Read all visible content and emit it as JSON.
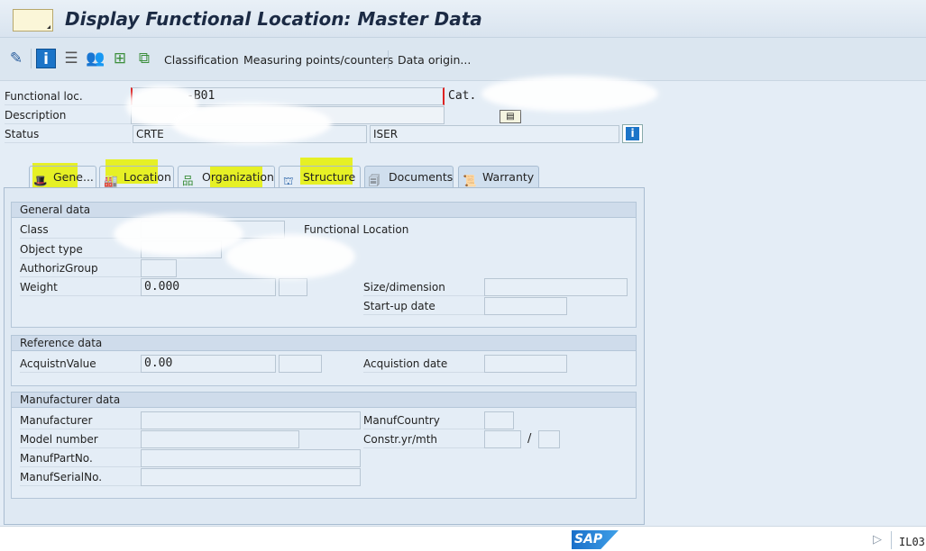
{
  "title": "Display Functional Location: Master Data",
  "toolbar": {
    "icons": [
      "display-change-icon",
      "info-icon",
      "text-icon",
      "partners-icon",
      "hierarchy-icon",
      "structure-icon"
    ],
    "items": [
      "Classification",
      "Measuring points/counters",
      "Data origin..."
    ]
  },
  "header": {
    "functional_loc_label": "Functional loc.",
    "functional_loc_value": "-B01",
    "cat_label": "Cat.",
    "description_label": "Description",
    "status_label": "Status",
    "status_value": "CRTE",
    "user_status_value": "ISER"
  },
  "tabs": [
    {
      "label": "Gene...",
      "active": true
    },
    {
      "label": "Location"
    },
    {
      "label": "Organization"
    },
    {
      "label": "Structure"
    },
    {
      "label": "Documents"
    },
    {
      "label": "Warranty"
    }
  ],
  "general": {
    "title": "General data",
    "class_label": "Class",
    "class_text": "Functional Location",
    "object_type_label": "Object type",
    "authgroup_label": "AuthorizGroup",
    "weight_label": "Weight",
    "weight_value": "0.000",
    "size_label": "Size/dimension",
    "startup_label": "Start-up date"
  },
  "reference": {
    "title": "Reference data",
    "acq_value_label": "AcquistnValue",
    "acq_value": "0.00",
    "acq_date_label": "Acquistion date"
  },
  "manufacturer": {
    "title": "Manufacturer data",
    "manufacturer_label": "Manufacturer",
    "country_label": "ManufCountry",
    "model_label": "Model number",
    "constr_label": "Constr.yr/mth",
    "slash": "/",
    "partno_label": "ManufPartNo.",
    "serial_label": "ManufSerialNo."
  },
  "statusbar": {
    "logo": "SAP",
    "transaction": "IL03"
  }
}
